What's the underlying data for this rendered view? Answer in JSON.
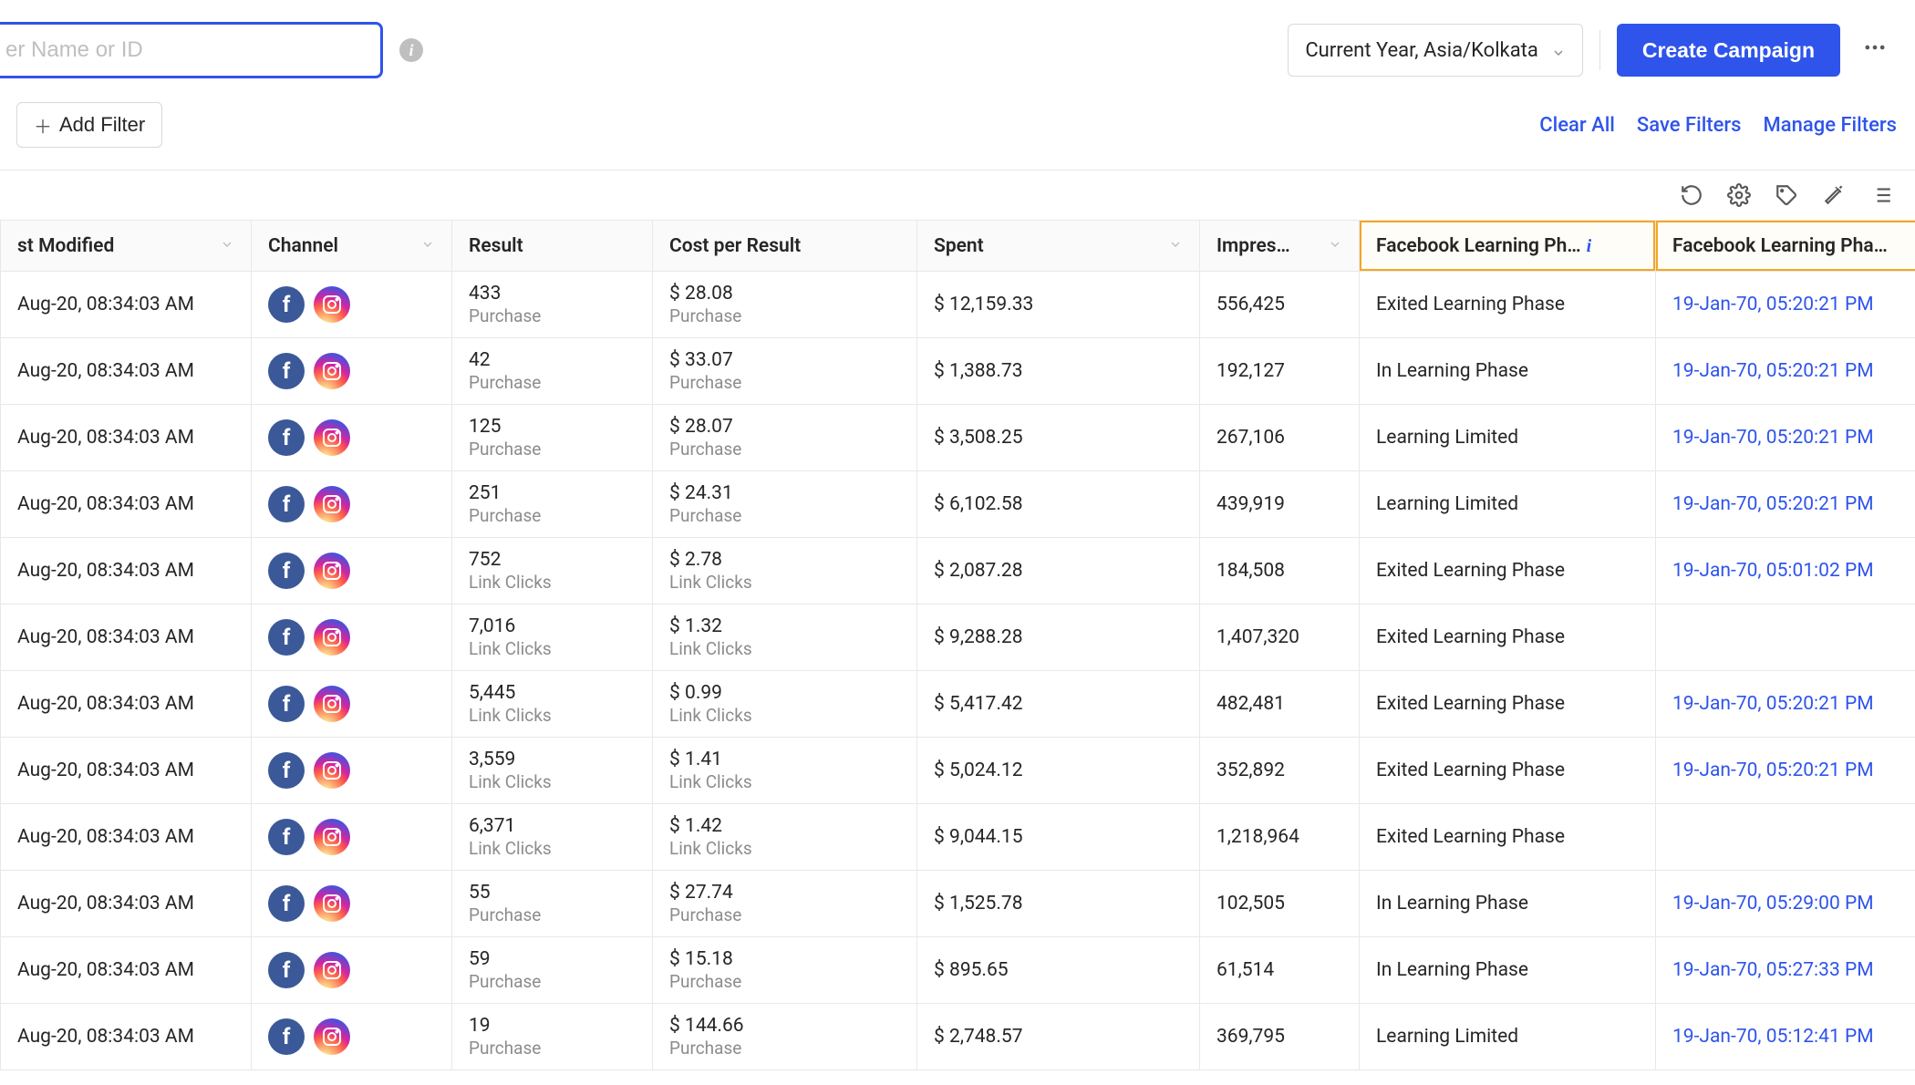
{
  "header": {
    "search_placeholder": "er Name or ID",
    "timezone_label": "Current Year, Asia/Kolkata",
    "create_label": "Create Campaign"
  },
  "filters": {
    "add_filter": "Add Filter",
    "clear_all": "Clear All",
    "save_filters": "Save Filters",
    "manage_filters": "Manage Filters"
  },
  "columns": {
    "modified": "st Modified",
    "channel": "Channel",
    "result": "Result",
    "cpr": "Cost per Result",
    "spent": "Spent",
    "impressions": "Impres…",
    "lp1": "Facebook Learning Ph…",
    "lp2": "Facebook Learning Pha…"
  },
  "rows": [
    {
      "modified": "Aug-20, 08:34:03 AM",
      "result_v": "433",
      "result_t": "Purchase",
      "cpr_v": "$ 28.08",
      "cpr_t": "Purchase",
      "spent": "$ 12,159.33",
      "imp": "556,425",
      "phase": "Exited Learning Phase",
      "date": "19-Jan-70, 05:20:21 PM"
    },
    {
      "modified": "Aug-20, 08:34:03 AM",
      "result_v": "42",
      "result_t": "Purchase",
      "cpr_v": "$ 33.07",
      "cpr_t": "Purchase",
      "spent": "$ 1,388.73",
      "imp": "192,127",
      "phase": "In Learning Phase",
      "date": "19-Jan-70, 05:20:21 PM"
    },
    {
      "modified": "Aug-20, 08:34:03 AM",
      "result_v": "125",
      "result_t": "Purchase",
      "cpr_v": "$ 28.07",
      "cpr_t": "Purchase",
      "spent": "$ 3,508.25",
      "imp": "267,106",
      "phase": "Learning Limited",
      "date": "19-Jan-70, 05:20:21 PM"
    },
    {
      "modified": "Aug-20, 08:34:03 AM",
      "result_v": "251",
      "result_t": "Purchase",
      "cpr_v": "$ 24.31",
      "cpr_t": "Purchase",
      "spent": "$ 6,102.58",
      "imp": "439,919",
      "phase": "Learning Limited",
      "date": "19-Jan-70, 05:20:21 PM"
    },
    {
      "modified": "Aug-20, 08:34:03 AM",
      "result_v": "752",
      "result_t": "Link Clicks",
      "cpr_v": "$ 2.78",
      "cpr_t": "Link Clicks",
      "spent": "$ 2,087.28",
      "imp": "184,508",
      "phase": "Exited Learning Phase",
      "date": "19-Jan-70, 05:01:02 PM"
    },
    {
      "modified": "Aug-20, 08:34:03 AM",
      "result_v": "7,016",
      "result_t": "Link Clicks",
      "cpr_v": "$ 1.32",
      "cpr_t": "Link Clicks",
      "spent": "$ 9,288.28",
      "imp": "1,407,320",
      "phase": "Exited Learning Phase",
      "date": ""
    },
    {
      "modified": "Aug-20, 08:34:03 AM",
      "result_v": "5,445",
      "result_t": "Link Clicks",
      "cpr_v": "$ 0.99",
      "cpr_t": "Link Clicks",
      "spent": "$ 5,417.42",
      "imp": "482,481",
      "phase": "Exited Learning Phase",
      "date": "19-Jan-70, 05:20:21 PM"
    },
    {
      "modified": "Aug-20, 08:34:03 AM",
      "result_v": "3,559",
      "result_t": "Link Clicks",
      "cpr_v": "$ 1.41",
      "cpr_t": "Link Clicks",
      "spent": "$ 5,024.12",
      "imp": "352,892",
      "phase": "Exited Learning Phase",
      "date": "19-Jan-70, 05:20:21 PM"
    },
    {
      "modified": "Aug-20, 08:34:03 AM",
      "result_v": "6,371",
      "result_t": "Link Clicks",
      "cpr_v": "$ 1.42",
      "cpr_t": "Link Clicks",
      "spent": "$ 9,044.15",
      "imp": "1,218,964",
      "phase": "Exited Learning Phase",
      "date": ""
    },
    {
      "modified": "Aug-20, 08:34:03 AM",
      "result_v": "55",
      "result_t": "Purchase",
      "cpr_v": "$ 27.74",
      "cpr_t": "Purchase",
      "spent": "$ 1,525.78",
      "imp": "102,505",
      "phase": "In Learning Phase",
      "date": "19-Jan-70, 05:29:00 PM"
    },
    {
      "modified": "Aug-20, 08:34:03 AM",
      "result_v": "59",
      "result_t": "Purchase",
      "cpr_v": "$ 15.18",
      "cpr_t": "Purchase",
      "spent": "$ 895.65",
      "imp": "61,514",
      "phase": "In Learning Phase",
      "date": "19-Jan-70, 05:27:33 PM"
    },
    {
      "modified": "Aug-20, 08:34:03 AM",
      "result_v": "19",
      "result_t": "Purchase",
      "cpr_v": "$ 144.66",
      "cpr_t": "Purchase",
      "spent": "$ 2,748.57",
      "imp": "369,795",
      "phase": "Learning Limited",
      "date": "19-Jan-70, 05:12:41 PM"
    }
  ]
}
